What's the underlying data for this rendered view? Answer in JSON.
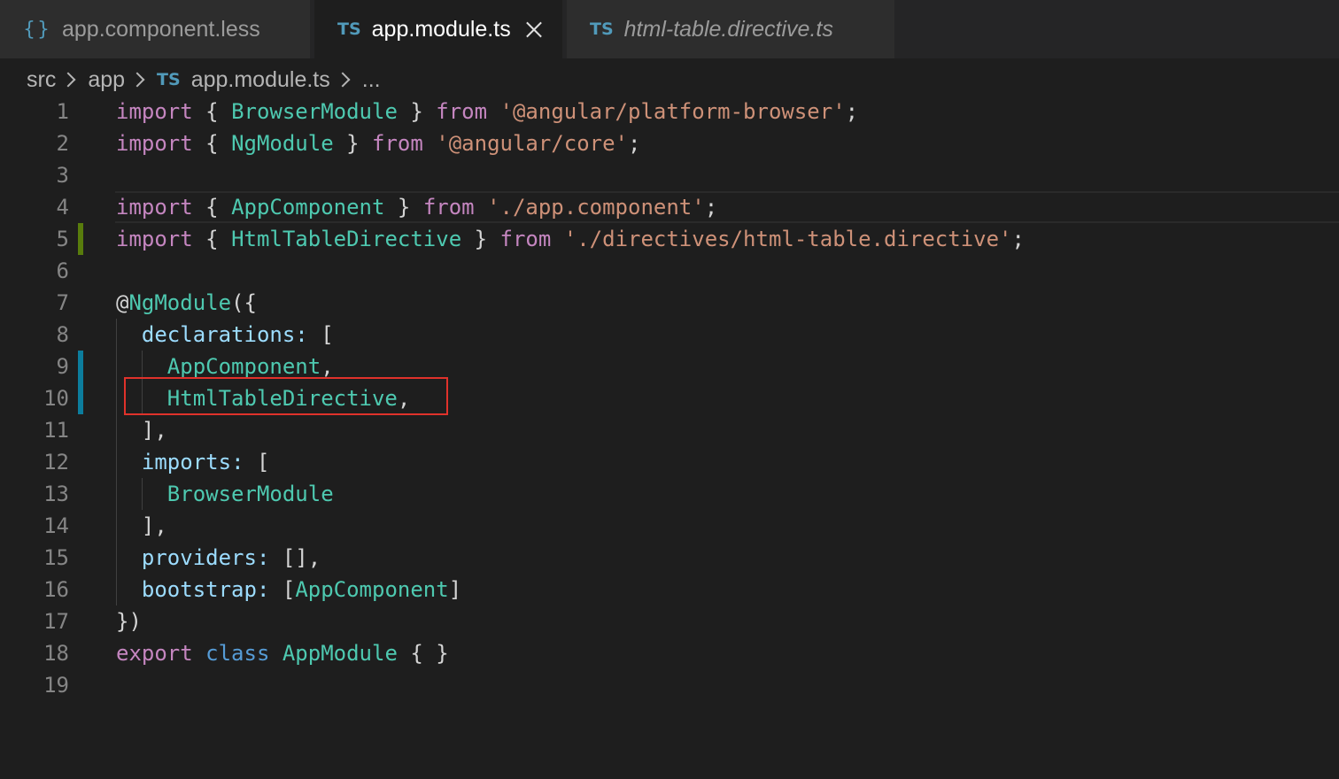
{
  "tabs": [
    {
      "icon": "{}",
      "label": "app.component.less",
      "active": false,
      "italic": false
    },
    {
      "icon": "TS",
      "label": "app.module.ts",
      "active": true,
      "italic": false
    },
    {
      "icon": "TS",
      "label": "html-table.directive.ts",
      "active": false,
      "italic": true
    }
  ],
  "breadcrumb": {
    "parts": [
      "src",
      "app"
    ],
    "file_icon": "TS",
    "file": "app.module.ts",
    "ellipsis": "..."
  },
  "colors": {
    "keyword": "#c586c0",
    "type": "#4ec9b0",
    "property": "#9cdcfe",
    "string": "#ce9178",
    "highlight_box": "#e0322b",
    "gutter_added": "#587c0c",
    "gutter_modified": "#0c7d9d"
  },
  "code": {
    "lines": [
      {
        "n": "1",
        "t": [
          [
            "kw",
            "import"
          ],
          [
            "pun",
            " { "
          ],
          [
            "ty",
            "BrowserModule"
          ],
          [
            "pun",
            " } "
          ],
          [
            "kw",
            "from"
          ],
          [
            "pun",
            " "
          ],
          [
            "str",
            "'@angular/platform-browser'"
          ],
          [
            "pun",
            ";"
          ]
        ]
      },
      {
        "n": "2",
        "t": [
          [
            "kw",
            "import"
          ],
          [
            "pun",
            " { "
          ],
          [
            "ty",
            "NgModule"
          ],
          [
            "pun",
            " } "
          ],
          [
            "kw",
            "from"
          ],
          [
            "pun",
            " "
          ],
          [
            "str",
            "'@angular/core'"
          ],
          [
            "pun",
            ";"
          ]
        ]
      },
      {
        "n": "3",
        "t": []
      },
      {
        "n": "4",
        "t": [
          [
            "kw",
            "import"
          ],
          [
            "pun",
            " { "
          ],
          [
            "ty",
            "AppComponent"
          ],
          [
            "pun",
            " } "
          ],
          [
            "kw",
            "from"
          ],
          [
            "pun",
            " "
          ],
          [
            "str",
            "'./app.component'"
          ],
          [
            "pun",
            ";"
          ]
        ],
        "current": true
      },
      {
        "n": "5",
        "t": [
          [
            "kw",
            "import"
          ],
          [
            "pun",
            " { "
          ],
          [
            "ty",
            "HtmlTableDirective"
          ],
          [
            "pun",
            " } "
          ],
          [
            "kw",
            "from"
          ],
          [
            "pun",
            " "
          ],
          [
            "str",
            "'./directives/html-table.directive'"
          ],
          [
            "pun",
            ";"
          ]
        ],
        "gutter": "added"
      },
      {
        "n": "6",
        "t": []
      },
      {
        "n": "7",
        "t": [
          [
            "pun",
            "@"
          ],
          [
            "ty",
            "NgModule"
          ],
          [
            "pun",
            "({"
          ]
        ]
      },
      {
        "n": "8",
        "t": [
          [
            "pun",
            "  "
          ],
          [
            "prop",
            "declarations"
          ],
          [
            "prop",
            ":"
          ],
          [
            "pun",
            " ["
          ]
        ],
        "guides": 1
      },
      {
        "n": "9",
        "t": [
          [
            "pun",
            "    "
          ],
          [
            "ty",
            "AppComponent"
          ],
          [
            "pun",
            ","
          ]
        ],
        "guides": 2,
        "gutter": "modified"
      },
      {
        "n": "10",
        "t": [
          [
            "pun",
            "    "
          ],
          [
            "ty",
            "HtmlTableDirective"
          ],
          [
            "pun",
            ","
          ]
        ],
        "guides": 2,
        "gutter": "modified"
      },
      {
        "n": "11",
        "t": [
          [
            "pun",
            "  ],"
          ]
        ],
        "guides": 1
      },
      {
        "n": "12",
        "t": [
          [
            "pun",
            "  "
          ],
          [
            "prop",
            "imports"
          ],
          [
            "prop",
            ":"
          ],
          [
            "pun",
            " ["
          ]
        ],
        "guides": 1
      },
      {
        "n": "13",
        "t": [
          [
            "pun",
            "    "
          ],
          [
            "ty",
            "BrowserModule"
          ]
        ],
        "guides": 2
      },
      {
        "n": "14",
        "t": [
          [
            "pun",
            "  ],"
          ]
        ],
        "guides": 1
      },
      {
        "n": "15",
        "t": [
          [
            "pun",
            "  "
          ],
          [
            "prop",
            "providers"
          ],
          [
            "prop",
            ":"
          ],
          [
            "pun",
            " [],"
          ]
        ],
        "guides": 1
      },
      {
        "n": "16",
        "t": [
          [
            "pun",
            "  "
          ],
          [
            "prop",
            "bootstrap"
          ],
          [
            "prop",
            ":"
          ],
          [
            "pun",
            " ["
          ],
          [
            "ty",
            "AppComponent"
          ],
          [
            "pun",
            "]"
          ]
        ],
        "guides": 1
      },
      {
        "n": "17",
        "t": [
          [
            "pun",
            "})"
          ]
        ]
      },
      {
        "n": "18",
        "t": [
          [
            "kw",
            "export"
          ],
          [
            "pun",
            " "
          ],
          [
            "kwb",
            "class"
          ],
          [
            "pun",
            " "
          ],
          [
            "ty",
            "AppModule"
          ],
          [
            "pun",
            " { }"
          ]
        ]
      },
      {
        "n": "19",
        "t": []
      }
    ]
  }
}
